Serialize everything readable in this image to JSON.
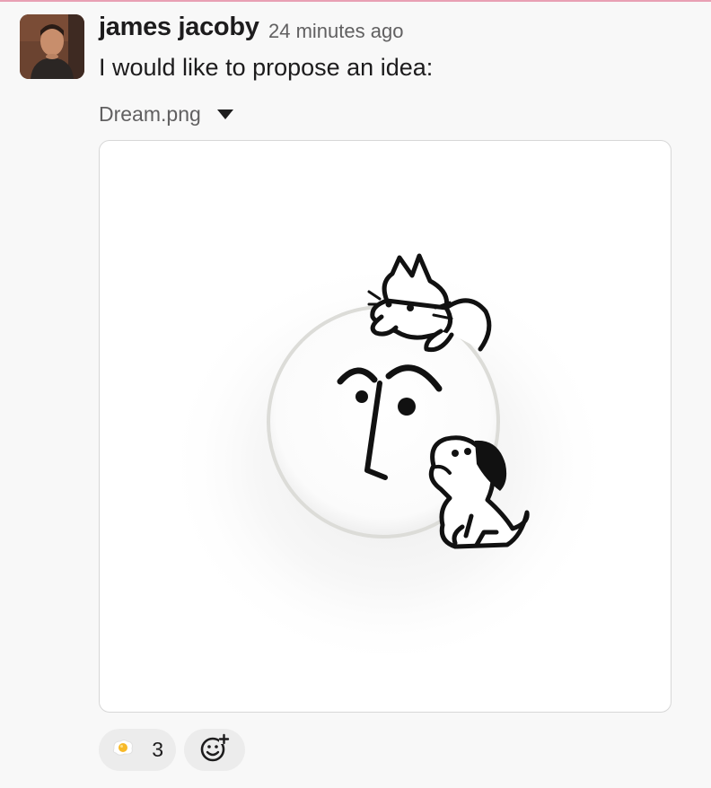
{
  "message": {
    "sender": "james jacoby",
    "timestamp": "24 minutes ago",
    "text": "I would like to propose an idea:",
    "attachment": {
      "file_name": "Dream.png",
      "toggle_icon": "caret-down-icon"
    },
    "reactions": [
      {
        "emoji": "fried-egg-icon",
        "count": "3"
      }
    ],
    "add_reaction_icon": "add-reaction-icon"
  },
  "colors": {
    "accent_line": "#e8a0b4",
    "background": "#f8f8f8",
    "reaction_bg": "#ececec",
    "muted_text": "#616061"
  }
}
